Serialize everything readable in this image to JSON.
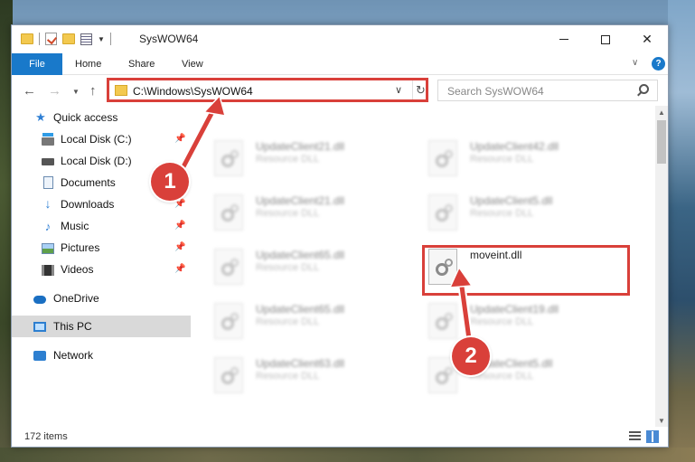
{
  "window": {
    "title": "SysWOW64"
  },
  "ribbon": {
    "file": "File",
    "home": "Home",
    "share": "Share",
    "view": "View",
    "help": "?"
  },
  "nav": {
    "address": "C:\\Windows\\SysWOW64",
    "search_placeholder": "Search SysWOW64"
  },
  "sidebar": {
    "items": [
      {
        "label": "Quick access",
        "icon": "star-icon"
      },
      {
        "label": "Local Disk (C:)",
        "icon": "drive-icon",
        "pinned": true
      },
      {
        "label": "Local Disk (D:)",
        "icon": "drive-icon"
      },
      {
        "label": "Documents",
        "icon": "documents-icon",
        "pinned": true
      },
      {
        "label": "Downloads",
        "icon": "download-icon",
        "pinned": true
      },
      {
        "label": "Music",
        "icon": "music-icon",
        "pinned": true
      },
      {
        "label": "Pictures",
        "icon": "pictures-icon",
        "pinned": true
      },
      {
        "label": "Videos",
        "icon": "videos-icon",
        "pinned": true
      },
      {
        "label": "OneDrive",
        "icon": "onedrive-icon"
      },
      {
        "label": "This PC",
        "icon": "computer-icon",
        "selected": true
      },
      {
        "label": "Network",
        "icon": "network-icon"
      }
    ]
  },
  "files": [
    {
      "name": "UpdateClient21.dll",
      "type": "Resource DLL"
    },
    {
      "name": "UpdateClient42.dll",
      "type": "Resource DLL"
    },
    {
      "name": "UpdateClient21.dll",
      "type": "Resource DLL"
    },
    {
      "name": "UpdateClient5.dll",
      "type": "Resource DLL"
    },
    {
      "name": "UpdateClient65.dll",
      "type": "Resource DLL"
    },
    {
      "name": "moveint.dll",
      "type": ""
    },
    {
      "name": "UpdateClient65.dll",
      "type": "Resource DLL"
    },
    {
      "name": "UpdateClient19.dll",
      "type": "Resource DLL"
    },
    {
      "name": "UpdateClient63.dll",
      "type": "Resource DLL"
    },
    {
      "name": "UpdateClient5.dll",
      "type": "Resource DLL"
    }
  ],
  "status": {
    "item_count": "172 items"
  },
  "annotations": {
    "step1": "1",
    "step2": "2"
  },
  "colors": {
    "accent": "#1979ca",
    "highlight": "#d9403a"
  }
}
